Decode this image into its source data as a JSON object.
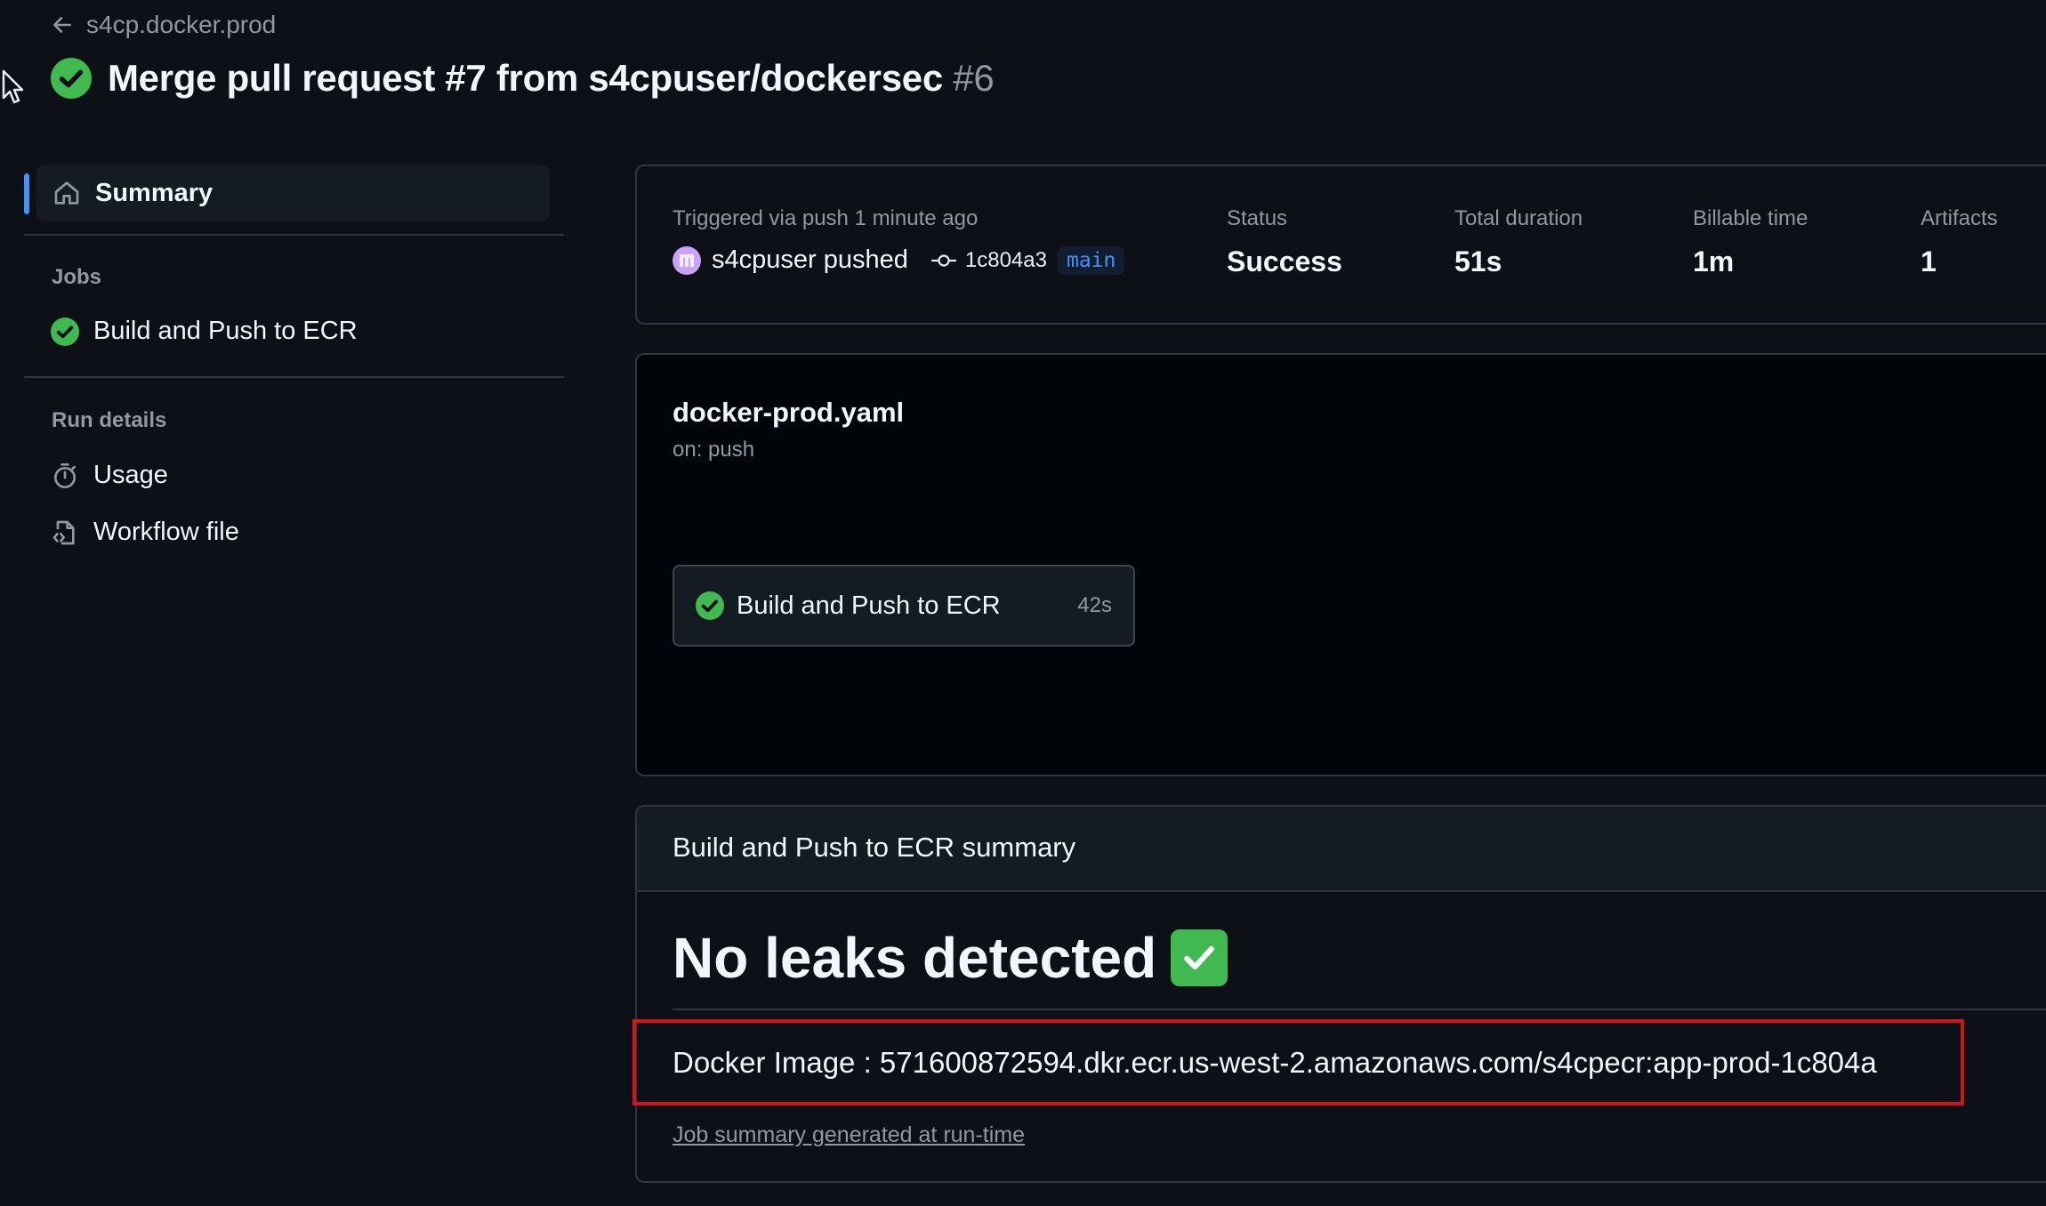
{
  "header": {
    "back_label": "s4cp.docker.prod",
    "title": "Merge pull request #7 from s4cpuser/dockersec",
    "run_number": "#6"
  },
  "sidebar": {
    "summary_label": "Summary",
    "jobs_heading": "Jobs",
    "jobs": [
      {
        "label": "Build and Push to ECR",
        "status": "success"
      }
    ],
    "run_details_heading": "Run details",
    "run_details": [
      {
        "label": "Usage",
        "icon": "stopwatch-icon"
      },
      {
        "label": "Workflow file",
        "icon": "file-code-icon"
      }
    ]
  },
  "run_info": {
    "trigger_text": "Triggered via push 1 minute ago",
    "actor": "s4cpuser pushed",
    "commit": "1c804a3",
    "branch": "main",
    "status_label": "Status",
    "status_value": "Success",
    "duration_label": "Total duration",
    "duration_value": "51s",
    "billable_label": "Billable time",
    "billable_value": "1m",
    "artifacts_label": "Artifacts",
    "artifacts_value": "1"
  },
  "workflow": {
    "file": "docker-prod.yaml",
    "trigger": "on: push",
    "job": {
      "label": "Build and Push to ECR",
      "duration": "42s"
    }
  },
  "job_summary": {
    "title": "Build and Push to ECR summary",
    "heading": "No leaks detected",
    "docker_image": "Docker Image : 571600872594.dkr.ecr.us-west-2.amazonaws.com/s4cpecr:app-prod-1c804a",
    "footer_link": "Job summary generated at run-time"
  },
  "colors": {
    "background": "#0d1117",
    "success": "#3fb950",
    "accent": "#4493f8",
    "highlight": "#d0141b"
  }
}
